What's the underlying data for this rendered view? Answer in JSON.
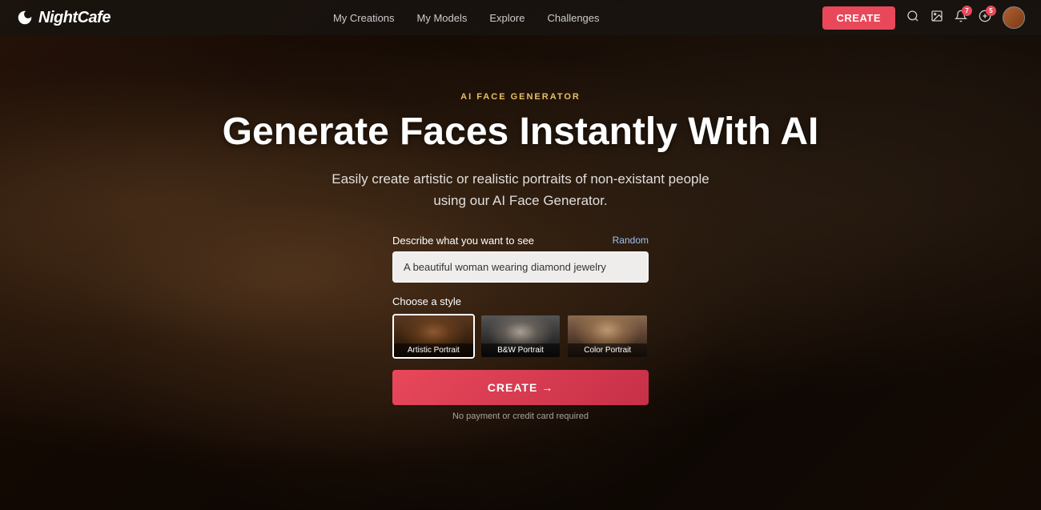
{
  "brand": {
    "logo_text": "NightCafe",
    "logo_icon": "moon-star"
  },
  "navbar": {
    "links": [
      {
        "label": "My Creations",
        "id": "my-creations"
      },
      {
        "label": "My Models",
        "id": "my-models"
      },
      {
        "label": "Explore",
        "id": "explore"
      },
      {
        "label": "Challenges",
        "id": "challenges"
      }
    ],
    "create_button": "CREATE",
    "notification_badge": "7",
    "credits_badge": "5"
  },
  "hero": {
    "section_label": "AI FACE GENERATOR",
    "main_title": "Generate Faces Instantly With AI",
    "subtitle_line1": "Easily create artistic or realistic portraits of non-existant people",
    "subtitle_line2": "using our AI Face Generator."
  },
  "form": {
    "input_label": "Describe what you want to see",
    "random_label": "Random",
    "input_placeholder": "A beautiful woman wearing diamond jewelry",
    "input_value": "A beautiful woman wearing diamond jewelry",
    "style_label": "Choose a style",
    "styles": [
      {
        "id": "artistic",
        "label": "Artistic Portrait",
        "selected": true
      },
      {
        "id": "bw",
        "label": "B&W Portrait",
        "selected": false
      },
      {
        "id": "color",
        "label": "Color Portrait",
        "selected": false
      }
    ],
    "create_button": "CREATE →",
    "no_payment_text": "No payment or credit card required"
  },
  "icons": {
    "search": "🔍",
    "image_gallery": "🖼",
    "bell": "🔔",
    "arrow_right": "→"
  }
}
